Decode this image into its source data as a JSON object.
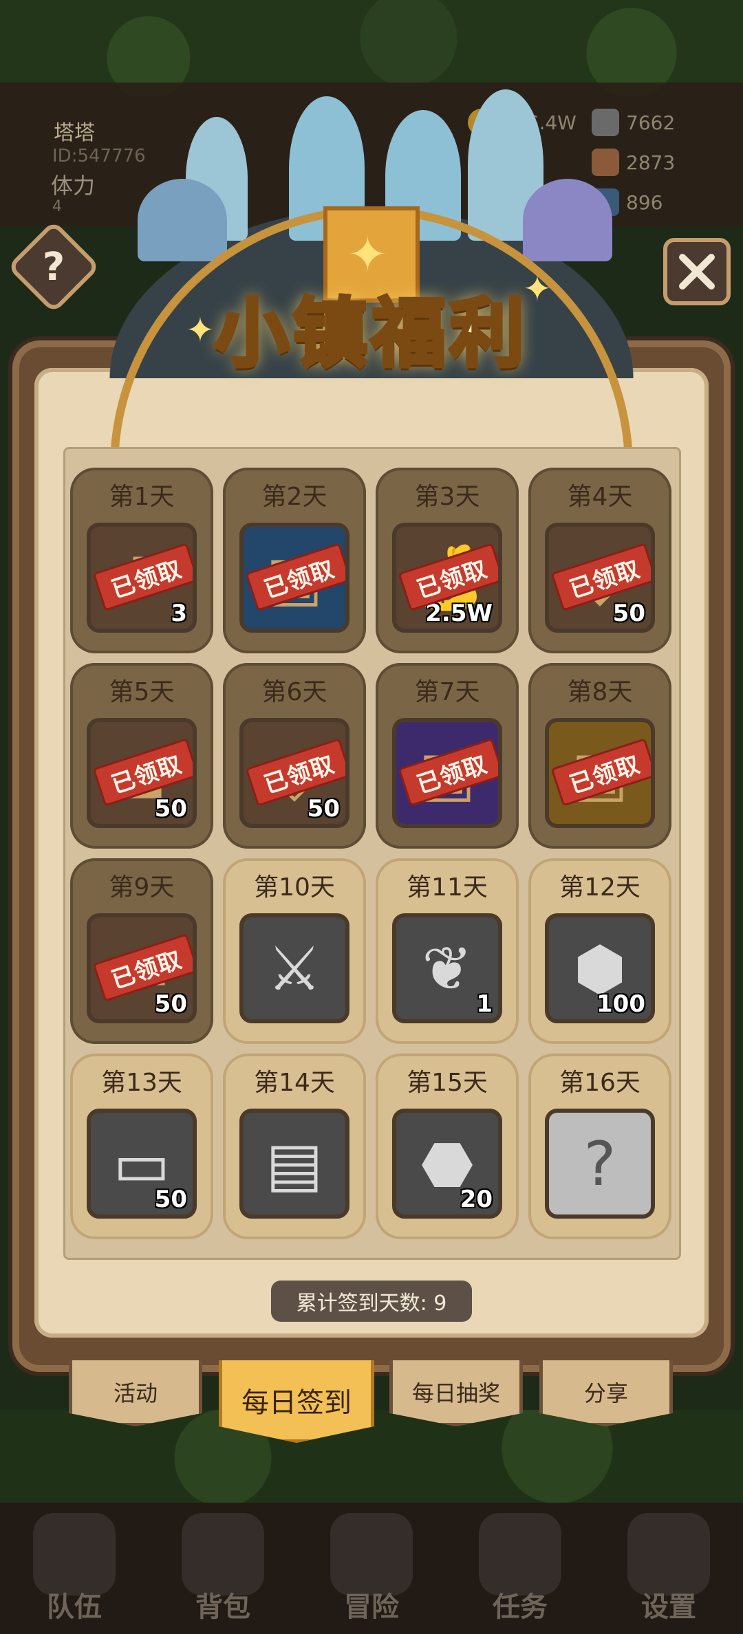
{
  "player": {
    "name": "塔塔",
    "id": "ID:547776",
    "stamina_label": "体力",
    "stamina_value": "4"
  },
  "resources": [
    {
      "icon": "gold-coin-icon",
      "value": "266.4W"
    },
    {
      "icon": "iron-ingot-icon",
      "value": "7662"
    },
    {
      "icon": "copper-ore-icon",
      "value": "2873"
    },
    {
      "icon": "blue-gem-icon",
      "value": "896"
    }
  ],
  "panel": {
    "title": "小镇福利",
    "help_label": "?",
    "total_label": "累计签到天数: 9"
  },
  "stamp_text": "已领取",
  "days": [
    {
      "label": "第1天",
      "icon": "potion-icon",
      "count": "3",
      "claimed": true,
      "theme": "brown"
    },
    {
      "label": "第2天",
      "icon": "blue-chest-icon",
      "count": "",
      "claimed": true,
      "theme": "blue"
    },
    {
      "label": "第3天",
      "icon": "gold-bag-icon",
      "count": "2.5W",
      "claimed": true,
      "theme": "brown"
    },
    {
      "label": "第4天",
      "icon": "blue-gem-icon",
      "count": "50",
      "claimed": true,
      "theme": "brown"
    },
    {
      "label": "第5天",
      "icon": "iron-ore-icon",
      "count": "50",
      "claimed": true,
      "theme": "brown"
    },
    {
      "label": "第6天",
      "icon": "copper-ore-icon",
      "count": "50",
      "claimed": true,
      "theme": "brown"
    },
    {
      "label": "第7天",
      "icon": "purple-chest-icon",
      "count": "",
      "claimed": true,
      "theme": "purple"
    },
    {
      "label": "第8天",
      "icon": "gold-chest-icon",
      "count": "",
      "claimed": true,
      "theme": "gold"
    },
    {
      "label": "第9天",
      "icon": "iron-ingot-icon",
      "count": "50",
      "claimed": true,
      "theme": "brown"
    },
    {
      "label": "第10天",
      "icon": "sword-icon",
      "count": "",
      "claimed": false,
      "theme": "grey"
    },
    {
      "label": "第11天",
      "icon": "feather-icon",
      "count": "1",
      "claimed": false,
      "theme": "grey"
    },
    {
      "label": "第12天",
      "icon": "crystal-icon",
      "count": "100",
      "claimed": false,
      "theme": "grey"
    },
    {
      "label": "第13天",
      "icon": "log-icon",
      "count": "50",
      "claimed": false,
      "theme": "grey"
    },
    {
      "label": "第14天",
      "icon": "backpack-icon",
      "count": "",
      "claimed": false,
      "theme": "grey"
    },
    {
      "label": "第15天",
      "icon": "rune-stone-icon",
      "count": "20",
      "claimed": false,
      "theme": "grey"
    },
    {
      "label": "第16天",
      "icon": "mystery-box-icon",
      "count": "",
      "claimed": false,
      "theme": "silver"
    }
  ],
  "tabs": [
    {
      "label": "活动",
      "active": false
    },
    {
      "label": "每日签到",
      "active": true
    },
    {
      "label": "每日抽奖",
      "active": false
    },
    {
      "label": "分享",
      "active": false
    }
  ],
  "nav": [
    {
      "label": "队伍",
      "icon": "helmet-icon"
    },
    {
      "label": "背包",
      "icon": "backpack-icon"
    },
    {
      "label": "冒险",
      "icon": "crossed-swords-icon"
    },
    {
      "label": "任务",
      "icon": "quest-icon"
    },
    {
      "label": "设置",
      "icon": "gear-icon"
    }
  ]
}
